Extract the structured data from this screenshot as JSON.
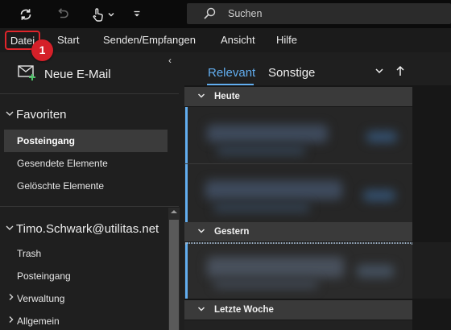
{
  "search": {
    "placeholder": "Suchen"
  },
  "quick_access": {
    "icons": [
      "sync-icon",
      "undo-icon",
      "touch-mode-icon",
      "chevron-down-icon",
      "customize-toolbar-icon"
    ]
  },
  "ribbon": {
    "tabs": [
      "Datei",
      "Start",
      "Senden/Empfangen",
      "Ansicht",
      "Hilfe"
    ],
    "callout": "1"
  },
  "nav": {
    "collapse_glyph": "‹",
    "new_mail": "Neue E-Mail",
    "favorites": {
      "title": "Favoriten",
      "items": [
        "Posteingang",
        "Gesendete Elemente",
        "Gelöschte Elemente"
      ],
      "selected": "Posteingang"
    },
    "account": {
      "title": "Timo.Schwark@utilitas.net",
      "items": [
        "Trash",
        "Posteingang",
        "Verwaltung",
        "Allgemein"
      ]
    }
  },
  "message_list": {
    "tabs": [
      "Relevant",
      "Sonstige"
    ],
    "active_tab": "Relevant",
    "groups": [
      "Heute",
      "Gestern",
      "Letzte Woche"
    ]
  },
  "colors": {
    "accent": "#62aef0",
    "callout_red": "#d52029",
    "highlight_border": "#e0252b"
  }
}
